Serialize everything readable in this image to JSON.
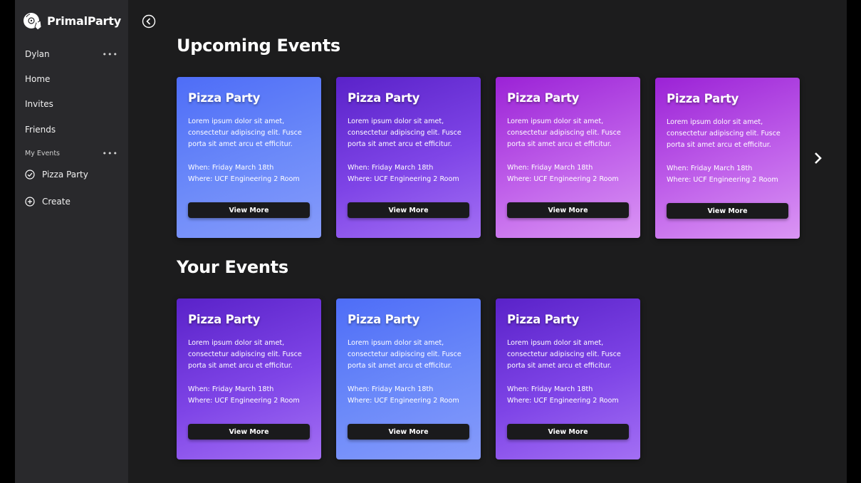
{
  "app": {
    "name": "PrimalParty"
  },
  "sidebar": {
    "user": "Dylan",
    "user_more": "•••",
    "nav": [
      {
        "label": "Home"
      },
      {
        "label": "Invites"
      },
      {
        "label": "Friends"
      }
    ],
    "section_label": "My Events",
    "section_more": "•••",
    "events": [
      {
        "label": "Pizza Party",
        "icon": "check-circle-icon"
      }
    ],
    "create_label": "Create",
    "create_icon": "plus-circle-icon"
  },
  "main": {
    "upcoming_title": "Upcoming Events",
    "your_title": "Your Events",
    "upcoming": [
      {
        "title": "Pizza Party",
        "desc_l1": "Lorem ipsum dolor sit amet,",
        "desc_l2": "consectetur adipiscing elit. Fusce",
        "desc_l3": "porta sit amet arcu et efficitur.",
        "when": "When: Friday March 18th",
        "where": "Where: UCF Engineering 2 Room",
        "button": "View More",
        "theme": "blue"
      },
      {
        "title": "Pizza Party",
        "desc_l1": "Lorem ipsum dolor sit amet,",
        "desc_l2": "consectetur adipiscing elit. Fusce",
        "desc_l3": "porta sit amet arcu et efficitur.",
        "when": "When: Friday March 18th",
        "where": "Where: UCF Engineering 2 Room",
        "button": "View More",
        "theme": "purple"
      },
      {
        "title": "Pizza Party",
        "desc_l1": "Lorem ipsum dolor sit amet,",
        "desc_l2": "consectetur adipiscing elit. Fusce",
        "desc_l3": "porta sit amet arcu et efficitur.",
        "when": "When: Friday March 18th",
        "where": "Where: UCF Engineering 2 Room",
        "button": "View More",
        "theme": "magenta"
      },
      {
        "title": "Pizza Party",
        "desc_l1": "Lorem ipsum dolor sit amet,",
        "desc_l2": "consectetur adipiscing elit. Fusce",
        "desc_l3": "porta sit amet arcu et efficitur.",
        "when": "When: Friday March 18th",
        "where": "Where: UCF Engineering 2 Room",
        "button": "View More",
        "theme": "magenta"
      }
    ],
    "yours": [
      {
        "title": "Pizza Party",
        "desc_l1": "Lorem ipsum dolor sit amet,",
        "desc_l2": "consectetur adipiscing elit. Fusce",
        "desc_l3": "porta sit amet arcu et efficitur.",
        "when": "When: Friday March 18th",
        "where": "Where: UCF Engineering 2 Room",
        "button": "View More",
        "theme": "purple"
      },
      {
        "title": "Pizza Party",
        "desc_l1": "Lorem ipsum dolor sit amet,",
        "desc_l2": "consectetur adipiscing elit. Fusce",
        "desc_l3": "porta sit amet arcu et efficitur.",
        "when": "When: Friday March 18th",
        "where": "Where: UCF Engineering 2 Room",
        "button": "View More",
        "theme": "blue"
      },
      {
        "title": "Pizza Party",
        "desc_l1": "Lorem ipsum dolor sit amet,",
        "desc_l2": "consectetur adipiscing elit. Fusce",
        "desc_l3": "porta sit amet arcu et efficitur.",
        "when": "When: Friday March 18th",
        "where": "Where: UCF Engineering 2 Room",
        "button": "View More",
        "theme": "purple"
      }
    ]
  },
  "colors": {
    "background": "#1c1c1d",
    "sidebar": "#29292c",
    "button": "#1a1a1c",
    "card_blue": "#6c8af9",
    "card_purple": "#7f45e7",
    "card_magenta": "#c061ea"
  }
}
